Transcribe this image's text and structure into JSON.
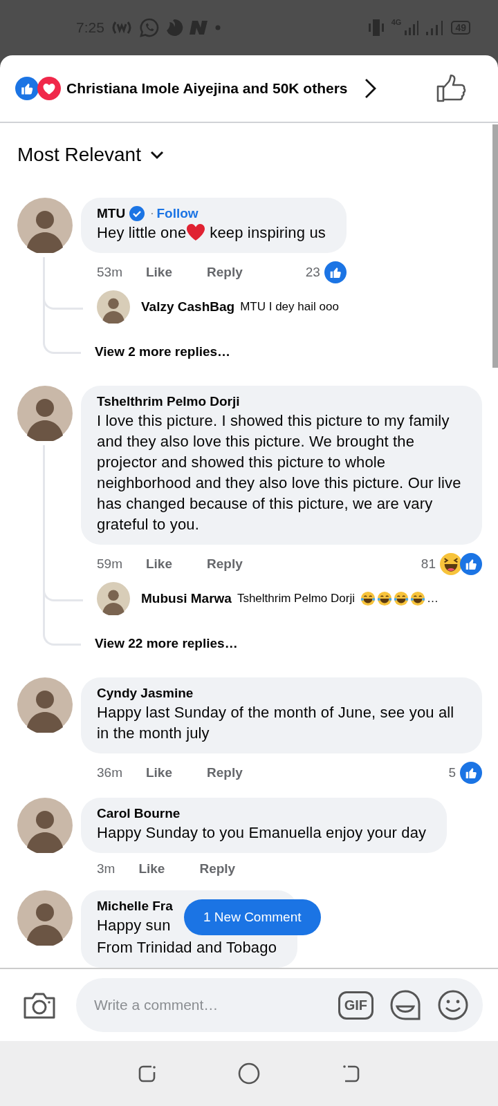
{
  "status_bar": {
    "time": "7:25",
    "network": "4G",
    "battery": "49"
  },
  "reactions_header": {
    "icons": [
      {
        "kind": "like"
      },
      {
        "kind": "love"
      }
    ],
    "summary": "Christiana Imole Aiyejina and 50K others"
  },
  "sort": {
    "label": "Most Relevant"
  },
  "comments": [
    {
      "name": "MTU",
      "verified": true,
      "follow_separator": "·",
      "follow": "Follow",
      "body": [
        {
          "kind": "text",
          "text": "Hey little one"
        },
        {
          "kind": "heart"
        },
        {
          "kind": "text",
          "text": "keep inspiring us"
        }
      ],
      "time": "53m",
      "like": "Like",
      "reply": "Reply",
      "reactions": {
        "count": "23",
        "icons": [
          {
            "kind": "like"
          }
        ]
      },
      "replies": [
        {
          "name": "Valzy CashBag",
          "body": [
            {
              "kind": "text",
              "text": "MTU I dey hail ooo"
            }
          ]
        }
      ],
      "more_replies": "View 2 more replies…"
    },
    {
      "name": "Tshelthrim Pelmo Dorji",
      "verified": false,
      "body": [
        {
          "kind": "text",
          "text": "I love this picture. I showed this picture to my family and they also love this picture. We brought the projector and showed this picture to whole neighborhood and they also love this picture. Our live has changed because of this picture, we are vary grateful to you."
        }
      ],
      "time": "59m",
      "like": "Like",
      "reply": "Reply",
      "reactions": {
        "count": "81",
        "icons": [
          {
            "kind": "haha"
          },
          {
            "kind": "like"
          }
        ]
      },
      "replies": [
        {
          "name": "Mubusi Marwa",
          "body": [
            {
              "kind": "text",
              "text": "Tshelthrim Pelmo Dorji"
            },
            {
              "kind": "laugh"
            },
            {
              "kind": "laugh"
            },
            {
              "kind": "laugh"
            },
            {
              "kind": "laugh"
            },
            {
              "kind": "text",
              "text": "…"
            }
          ]
        }
      ],
      "more_replies": "View 22 more replies…"
    },
    {
      "name": "Cyndy Jasmine",
      "verified": false,
      "body": [
        {
          "kind": "text",
          "text": "Happy last Sunday of the month of June, see you all in the month july"
        }
      ],
      "time": "36m",
      "like": "Like",
      "reply": "Reply",
      "reactions": {
        "count": "5",
        "icons": [
          {
            "kind": "like"
          }
        ]
      }
    },
    {
      "name": "Carol Bourne",
      "verified": false,
      "body": [
        {
          "kind": "text",
          "text": "Happy Sunday to you Emanuella enjoy your day"
        }
      ],
      "time": "3m",
      "like": "Like",
      "reply": "Reply"
    },
    {
      "name": "Michelle Fra",
      "verified": false,
      "body": [
        {
          "kind": "text",
          "text": "Happy sun"
        }
      ],
      "body_2": "From Trinidad and Tobago"
    }
  ],
  "new_comment_button": "1 New Comment",
  "composer": {
    "placeholder": "Write a comment…",
    "gif": "GIF"
  }
}
